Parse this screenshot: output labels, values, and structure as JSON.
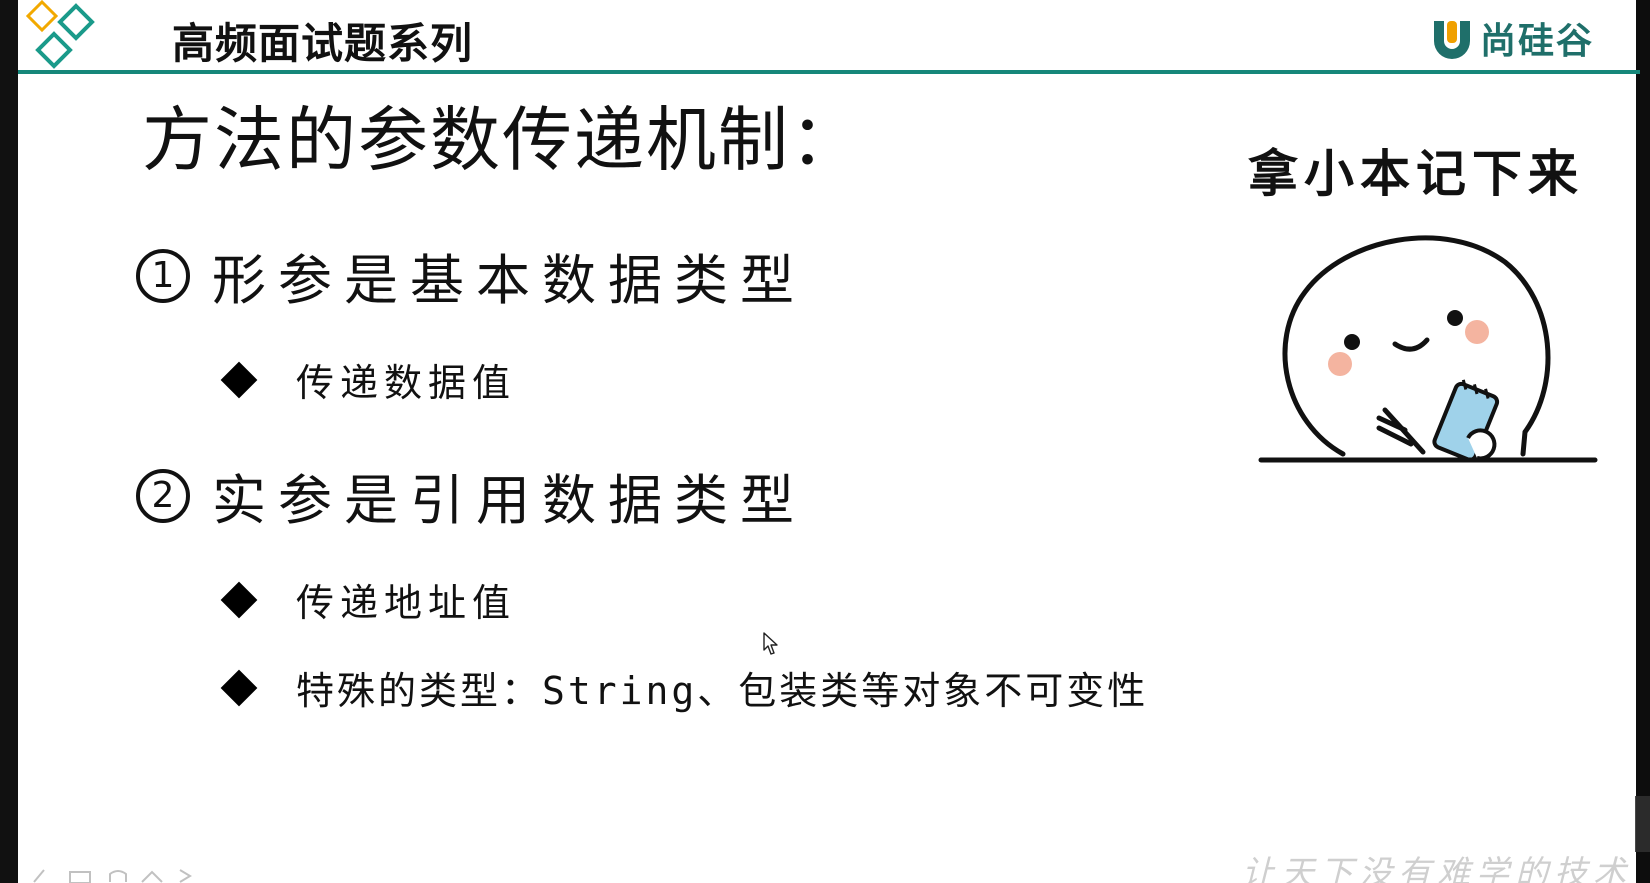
{
  "header": {
    "series_title": "高频面试题系列",
    "brand_name": "尚硅谷",
    "logo_icon": "diamond-tiles-logo-icon",
    "brand_icon": "u-badge-logo-icon",
    "rule_color": "#16877a"
  },
  "slide": {
    "title": "方法的参数传递机制：",
    "points": [
      {
        "number": "①",
        "label": "形参是基本数据类型",
        "bullets": [
          "传递数据值"
        ]
      },
      {
        "number": "②",
        "label": "实参是引用数据类型",
        "bullets": [
          "传递地址值",
          "特殊的类型：String、包装类等对象不可变性"
        ]
      }
    ],
    "sticker": {
      "caption": "拿小本记下来",
      "icon": "note-taking-character-icon"
    },
    "watermark": "让天下没有难学的技术"
  },
  "colors": {
    "accent": "#16877a",
    "brand_orange": "#f0a000",
    "text": "#111111"
  }
}
